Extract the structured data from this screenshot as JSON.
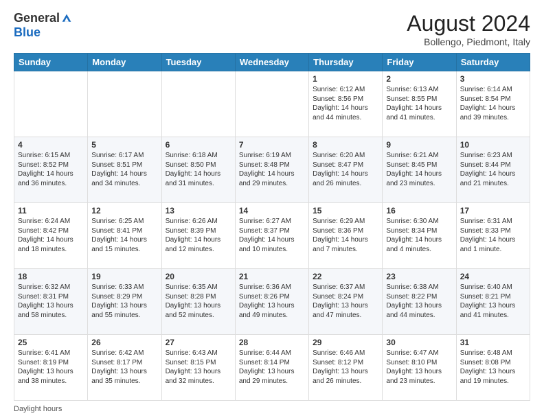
{
  "header": {
    "logo_general": "General",
    "logo_blue": "Blue",
    "main_title": "August 2024",
    "subtitle": "Bollengo, Piedmont, Italy"
  },
  "days_of_week": [
    "Sunday",
    "Monday",
    "Tuesday",
    "Wednesday",
    "Thursday",
    "Friday",
    "Saturday"
  ],
  "weeks": [
    [
      {
        "day": null
      },
      {
        "day": null
      },
      {
        "day": null
      },
      {
        "day": null
      },
      {
        "day": 1,
        "sunrise": "6:12 AM",
        "sunset": "8:56 PM",
        "daylight": "14 hours and 44 minutes."
      },
      {
        "day": 2,
        "sunrise": "6:13 AM",
        "sunset": "8:55 PM",
        "daylight": "14 hours and 41 minutes."
      },
      {
        "day": 3,
        "sunrise": "6:14 AM",
        "sunset": "8:54 PM",
        "daylight": "14 hours and 39 minutes."
      }
    ],
    [
      {
        "day": 4,
        "sunrise": "6:15 AM",
        "sunset": "8:52 PM",
        "daylight": "14 hours and 36 minutes."
      },
      {
        "day": 5,
        "sunrise": "6:17 AM",
        "sunset": "8:51 PM",
        "daylight": "14 hours and 34 minutes."
      },
      {
        "day": 6,
        "sunrise": "6:18 AM",
        "sunset": "8:50 PM",
        "daylight": "14 hours and 31 minutes."
      },
      {
        "day": 7,
        "sunrise": "6:19 AM",
        "sunset": "8:48 PM",
        "daylight": "14 hours and 29 minutes."
      },
      {
        "day": 8,
        "sunrise": "6:20 AM",
        "sunset": "8:47 PM",
        "daylight": "14 hours and 26 minutes."
      },
      {
        "day": 9,
        "sunrise": "6:21 AM",
        "sunset": "8:45 PM",
        "daylight": "14 hours and 23 minutes."
      },
      {
        "day": 10,
        "sunrise": "6:23 AM",
        "sunset": "8:44 PM",
        "daylight": "14 hours and 21 minutes."
      }
    ],
    [
      {
        "day": 11,
        "sunrise": "6:24 AM",
        "sunset": "8:42 PM",
        "daylight": "14 hours and 18 minutes."
      },
      {
        "day": 12,
        "sunrise": "6:25 AM",
        "sunset": "8:41 PM",
        "daylight": "14 hours and 15 minutes."
      },
      {
        "day": 13,
        "sunrise": "6:26 AM",
        "sunset": "8:39 PM",
        "daylight": "14 hours and 12 minutes."
      },
      {
        "day": 14,
        "sunrise": "6:27 AM",
        "sunset": "8:37 PM",
        "daylight": "14 hours and 10 minutes."
      },
      {
        "day": 15,
        "sunrise": "6:29 AM",
        "sunset": "8:36 PM",
        "daylight": "14 hours and 7 minutes."
      },
      {
        "day": 16,
        "sunrise": "6:30 AM",
        "sunset": "8:34 PM",
        "daylight": "14 hours and 4 minutes."
      },
      {
        "day": 17,
        "sunrise": "6:31 AM",
        "sunset": "8:33 PM",
        "daylight": "14 hours and 1 minute."
      }
    ],
    [
      {
        "day": 18,
        "sunrise": "6:32 AM",
        "sunset": "8:31 PM",
        "daylight": "13 hours and 58 minutes."
      },
      {
        "day": 19,
        "sunrise": "6:33 AM",
        "sunset": "8:29 PM",
        "daylight": "13 hours and 55 minutes."
      },
      {
        "day": 20,
        "sunrise": "6:35 AM",
        "sunset": "8:28 PM",
        "daylight": "13 hours and 52 minutes."
      },
      {
        "day": 21,
        "sunrise": "6:36 AM",
        "sunset": "8:26 PM",
        "daylight": "13 hours and 49 minutes."
      },
      {
        "day": 22,
        "sunrise": "6:37 AM",
        "sunset": "8:24 PM",
        "daylight": "13 hours and 47 minutes."
      },
      {
        "day": 23,
        "sunrise": "6:38 AM",
        "sunset": "8:22 PM",
        "daylight": "13 hours and 44 minutes."
      },
      {
        "day": 24,
        "sunrise": "6:40 AM",
        "sunset": "8:21 PM",
        "daylight": "13 hours and 41 minutes."
      }
    ],
    [
      {
        "day": 25,
        "sunrise": "6:41 AM",
        "sunset": "8:19 PM",
        "daylight": "13 hours and 38 minutes."
      },
      {
        "day": 26,
        "sunrise": "6:42 AM",
        "sunset": "8:17 PM",
        "daylight": "13 hours and 35 minutes."
      },
      {
        "day": 27,
        "sunrise": "6:43 AM",
        "sunset": "8:15 PM",
        "daylight": "13 hours and 32 minutes."
      },
      {
        "day": 28,
        "sunrise": "6:44 AM",
        "sunset": "8:14 PM",
        "daylight": "13 hours and 29 minutes."
      },
      {
        "day": 29,
        "sunrise": "6:46 AM",
        "sunset": "8:12 PM",
        "daylight": "13 hours and 26 minutes."
      },
      {
        "day": 30,
        "sunrise": "6:47 AM",
        "sunset": "8:10 PM",
        "daylight": "13 hours and 23 minutes."
      },
      {
        "day": 31,
        "sunrise": "6:48 AM",
        "sunset": "8:08 PM",
        "daylight": "13 hours and 19 minutes."
      }
    ]
  ],
  "footer": {
    "daylight_label": "Daylight hours"
  }
}
